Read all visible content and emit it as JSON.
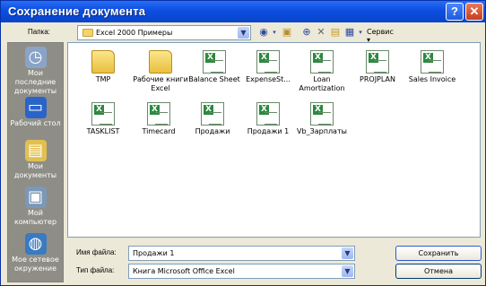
{
  "window": {
    "title": "Сохранение документа",
    "help": "?",
    "close": "✕"
  },
  "location": {
    "label": "Папка:",
    "value": "Excel 2000 Примеры"
  },
  "toolbar": {
    "tools_label": "Сервис"
  },
  "places": [
    {
      "label": "Мои последние документы",
      "icon": "recent-documents-icon"
    },
    {
      "label": "Рабочий стол",
      "icon": "desktop-icon"
    },
    {
      "label": "Мои документы",
      "icon": "my-documents-icon"
    },
    {
      "label": "Мой компьютер",
      "icon": "my-computer-icon"
    },
    {
      "label": "Мое сетевое окружение",
      "icon": "network-icon"
    }
  ],
  "files": [
    {
      "name": "TMP",
      "type": "folder"
    },
    {
      "name": "Рабочие книги Excel",
      "type": "folder"
    },
    {
      "name": "Balance Sheet",
      "type": "xls"
    },
    {
      "name": "ExpenseSt...",
      "type": "xls"
    },
    {
      "name": "Loan Amortization",
      "type": "xls"
    },
    {
      "name": "PROJPLAN",
      "type": "xls"
    },
    {
      "name": "Sales Invoice",
      "type": "xls"
    },
    {
      "name": "TASKLIST",
      "type": "xls"
    },
    {
      "name": "Timecard",
      "type": "xls"
    },
    {
      "name": "Продажи",
      "type": "xls"
    },
    {
      "name": "Продажи 1",
      "type": "xls"
    },
    {
      "name": "Vb_Зарплаты",
      "type": "xls"
    }
  ],
  "filename": {
    "label": "Имя файла:",
    "value": "Продажи 1"
  },
  "filetype": {
    "label": "Тип файла:",
    "value": "Книга Microsoft Office Excel"
  },
  "buttons": {
    "save": "Сохранить",
    "cancel": "Отмена"
  }
}
